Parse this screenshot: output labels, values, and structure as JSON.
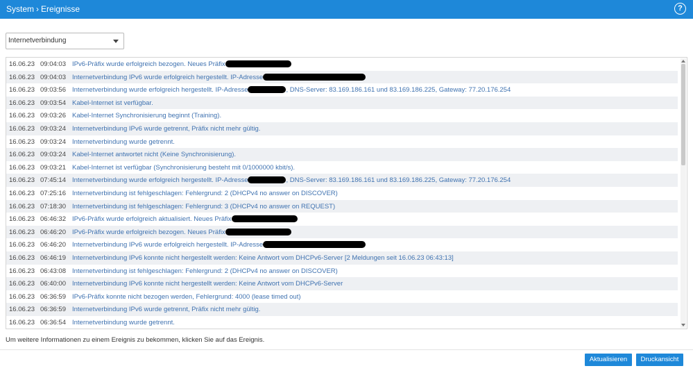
{
  "header": {
    "crumb_root": "System",
    "crumb_sep": "›",
    "crumb_page": "Ereignisse",
    "help_icon": "?"
  },
  "filter": {
    "selected": "Internetverbindung"
  },
  "redaction_color": "#000000",
  "log": [
    {
      "date": "16.06.23",
      "time": "09:04:03",
      "pre": "IPv6-Präfix wurde erfolgreich bezogen. Neues Präfix",
      "redacted": true,
      "post": ""
    },
    {
      "date": "16.06.23",
      "time": "09:04:03",
      "pre": "Internetverbindung IPv6 wurde erfolgreich hergestellt. IP-Adresse",
      "redacted": true,
      "post": ""
    },
    {
      "date": "16.06.23",
      "time": "09:03:56",
      "pre": "Internetverbindung wurde erfolgreich hergestellt. IP-Adresse",
      "redacted": true,
      "post": ", DNS-Server: 83.169.186.161 und 83.169.186.225, Gateway: 77.20.176.254"
    },
    {
      "date": "16.06.23",
      "time": "09:03:54",
      "pre": "Kabel-Internet ist verfügbar.",
      "redacted": false,
      "post": ""
    },
    {
      "date": "16.06.23",
      "time": "09:03:26",
      "pre": "Kabel-Internet Synchronisierung beginnt (Training).",
      "redacted": false,
      "post": ""
    },
    {
      "date": "16.06.23",
      "time": "09:03:24",
      "pre": "Internetverbindung IPv6 wurde getrennt, Präfix nicht mehr gültig.",
      "redacted": false,
      "post": ""
    },
    {
      "date": "16.06.23",
      "time": "09:03:24",
      "pre": "Internetverbindung wurde getrennt.",
      "redacted": false,
      "post": ""
    },
    {
      "date": "16.06.23",
      "time": "09:03:24",
      "pre": "Kabel-Internet antwortet nicht (Keine Synchronisierung).",
      "redacted": false,
      "post": ""
    },
    {
      "date": "16.06.23",
      "time": "09:03:21",
      "pre": "Kabel-Internet ist verfügbar (Synchronisierung besteht mit 0/1000000 kbit/s).",
      "redacted": false,
      "post": ""
    },
    {
      "date": "16.06.23",
      "time": "07:45:14",
      "pre": "Internetverbindung wurde erfolgreich hergestellt. IP-Adresse",
      "redacted": true,
      "post": ", DNS-Server: 83.169.186.161 und 83.169.186.225, Gateway: 77.20.176.254"
    },
    {
      "date": "16.06.23",
      "time": "07:25:16",
      "pre": "Internetverbindung ist fehlgeschlagen: Fehlergrund: 2 (DHCPv4 no answer on DISCOVER)",
      "redacted": false,
      "post": ""
    },
    {
      "date": "16.06.23",
      "time": "07:18:30",
      "pre": "Internetverbindung ist fehlgeschlagen: Fehlergrund: 3 (DHCPv4 no answer on REQUEST)",
      "redacted": false,
      "post": ""
    },
    {
      "date": "16.06.23",
      "time": "06:46:32",
      "pre": "IPv6-Präfix wurde erfolgreich aktualisiert. Neues Präfix",
      "redacted": true,
      "post": ""
    },
    {
      "date": "16.06.23",
      "time": "06:46:20",
      "pre": "IPv6-Präfix wurde erfolgreich bezogen. Neues Präfix",
      "redacted": true,
      "post": ""
    },
    {
      "date": "16.06.23",
      "time": "06:46:20",
      "pre": "Internetverbindung IPv6 wurde erfolgreich hergestellt. IP-Adresse",
      "redacted": true,
      "post": ""
    },
    {
      "date": "16.06.23",
      "time": "06:46:19",
      "pre": "Internetverbindung IPv6 konnte nicht hergestellt werden: Keine Antwort vom DHCPv6-Server [2 Meldungen seit 16.06.23 06:43:13]",
      "redacted": false,
      "post": ""
    },
    {
      "date": "16.06.23",
      "time": "06:43:08",
      "pre": "Internetverbindung ist fehlgeschlagen: Fehlergrund: 2 (DHCPv4 no answer on DISCOVER)",
      "redacted": false,
      "post": ""
    },
    {
      "date": "16.06.23",
      "time": "06:40:00",
      "pre": "Internetverbindung IPv6 konnte nicht hergestellt werden: Keine Antwort vom DHCPv6-Server",
      "redacted": false,
      "post": ""
    },
    {
      "date": "16.06.23",
      "time": "06:36:59",
      "pre": "IPv6-Präfix konnte nicht bezogen werden, Fehlergrund: 4000 (lease timed out)",
      "redacted": false,
      "post": ""
    },
    {
      "date": "16.06.23",
      "time": "06:36:59",
      "pre": "Internetverbindung IPv6 wurde getrennt, Präfix nicht mehr gültig.",
      "redacted": false,
      "post": ""
    },
    {
      "date": "16.06.23",
      "time": "06:36:54",
      "pre": "Internetverbindung wurde getrennt.",
      "redacted": false,
      "post": ""
    }
  ],
  "hint": "Um weitere Informationen zu einem Ereignis zu bekommen, klicken Sie auf das Ereignis.",
  "buttons": {
    "refresh": "Aktualisieren",
    "print": "Druckansicht"
  }
}
